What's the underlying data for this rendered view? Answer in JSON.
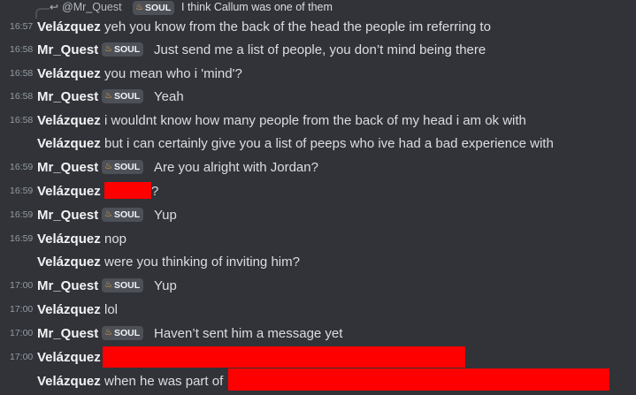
{
  "reply": {
    "author": "@Mr_Quest",
    "badge": "SOUL",
    "text": "I think Callum was one of them"
  },
  "badge_label": "SOUL",
  "messages": [
    {
      "time": "16:57",
      "author": "Velázquez",
      "text": "yeh you know from the back of the head the people im referring to"
    },
    {
      "time": "16:58",
      "author": "Mr_Quest",
      "badge": "SOUL",
      "text": "Just send me a list of people, you don’t mind being there"
    },
    {
      "time": "16:58",
      "author": "Velázquez",
      "text": "you mean who i 'mind'?"
    },
    {
      "time": "16:58",
      "author": "Mr_Quest",
      "badge": "SOUL",
      "text": "Yeah"
    },
    {
      "time": "16:58",
      "author": "Velázquez",
      "text": "i wouldnt know how many people from the back of my head i am ok with"
    },
    {
      "time": "",
      "author": "Velázquez",
      "text": "but i can certainly give you a list of peeps who ive had a bad experience with"
    },
    {
      "time": "16:59",
      "author": "Mr_Quest",
      "badge": "SOUL",
      "text": "Are you alright with Jordan?"
    },
    {
      "time": "16:59",
      "author": "Velázquez",
      "text": "?"
    },
    {
      "time": "16:59",
      "author": "Mr_Quest",
      "badge": "SOUL",
      "text": "Yup"
    },
    {
      "time": "16:59",
      "author": "Velázquez",
      "text": "nop"
    },
    {
      "time": "",
      "author": "Velázquez",
      "text": "were you thinking of inviting him?"
    },
    {
      "time": "17:00",
      "author": "Mr_Quest",
      "badge": "SOUL",
      "text": "Yup"
    },
    {
      "time": "17:00",
      "author": "Velázquez",
      "text": "lol"
    },
    {
      "time": "17:00",
      "author": "Mr_Quest",
      "badge": "SOUL",
      "text": "Haven’t sent him a message yet"
    },
    {
      "time": "17:00",
      "author": "Velázquez",
      "text": ""
    },
    {
      "time": "",
      "author": "Velázquez",
      "text": "when he was part of"
    }
  ],
  "colors": {
    "background": "#313338",
    "redaction": "#ff0000",
    "badge_bg": "#4e5058",
    "flame": "#f0b232"
  }
}
